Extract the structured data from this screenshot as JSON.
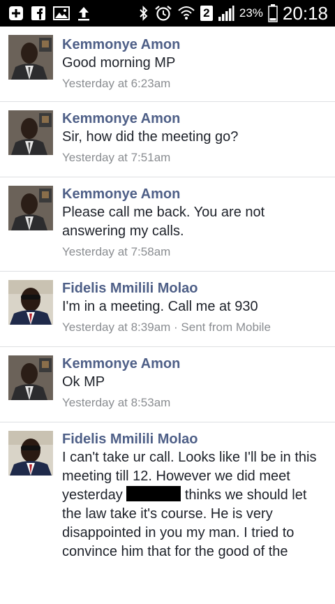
{
  "status_bar": {
    "icons": [
      "add-box-icon",
      "facebook-icon",
      "image-icon",
      "upload-icon",
      "bluetooth-icon",
      "alarm-icon",
      "wifi-icon",
      "sim2-icon",
      "signal-icon",
      "battery-icon"
    ],
    "sim_badge": "2",
    "battery": "23%",
    "time": "20:18"
  },
  "messages": [
    {
      "sender": "Kemmonye Amon",
      "text": "Good morning MP",
      "time": "Yesterday at 6:23am",
      "avatar": "kemmonye"
    },
    {
      "sender": "Kemmonye Amon",
      "text": "Sir, how did the meeting go?",
      "time": "Yesterday at 7:51am",
      "avatar": "kemmonye"
    },
    {
      "sender": "Kemmonye Amon",
      "text": "Please call me back. You are not answering my calls.",
      "time": "Yesterday at 7:58am",
      "avatar": "kemmonye"
    },
    {
      "sender": "Fidelis Mmilili Molao",
      "text": "I'm in a meeting. Call me at 930",
      "time": "Yesterday at 8:39am · Sent from Mobile",
      "avatar": "fidelis"
    },
    {
      "sender": "Kemmonye Amon",
      "text": "Ok MP",
      "time": "Yesterday at 8:53am",
      "avatar": "kemmonye"
    },
    {
      "sender": "Fidelis Mmilili Molao",
      "text_before_redaction": "I can't take ur call. Looks like I'll be in this meeting till 12. However we did meet yesterday",
      "text_after_redaction": "thinks we should let the law take it's course. He is very disappointed in you my man. I tried to convince him that for the good of the",
      "avatar": "fidelis"
    }
  ]
}
